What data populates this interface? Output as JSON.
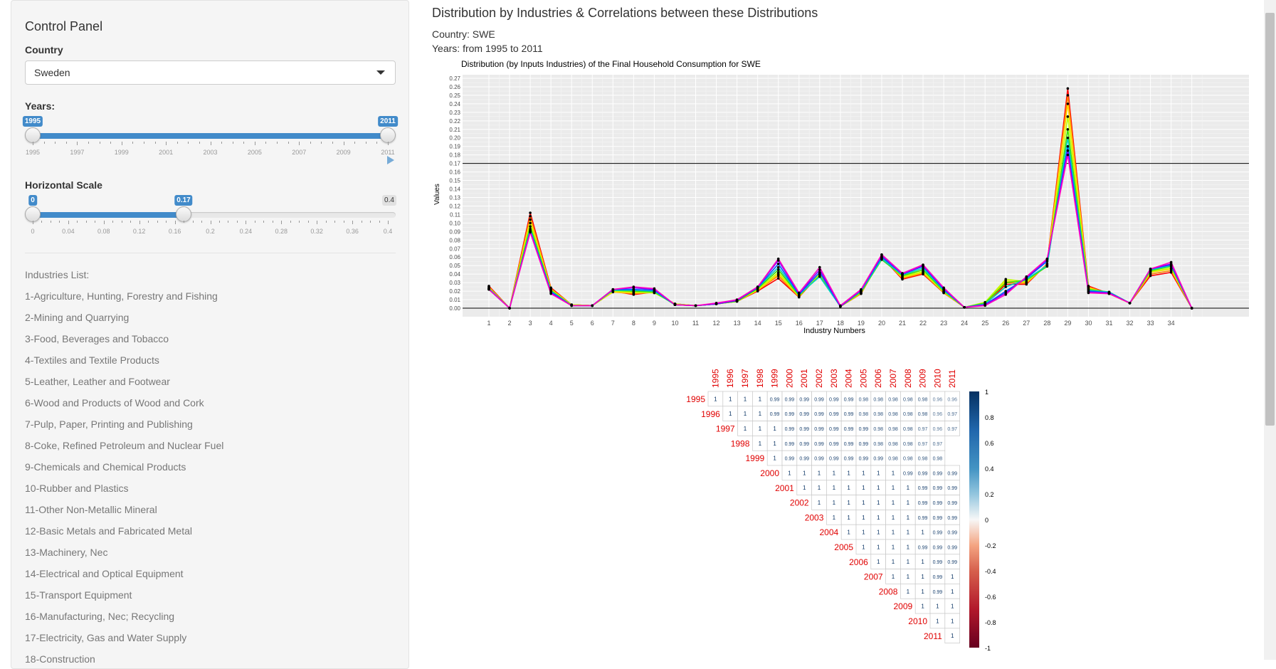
{
  "sidebar": {
    "title": "Control Panel",
    "country_label": "Country",
    "country_value": "Sweden",
    "years_label": "Years:",
    "years_from": "1995",
    "years_to": "2011",
    "years_ticks": [
      "1995",
      "1997",
      "1999",
      "2001",
      "2003",
      "2005",
      "2007",
      "2009",
      "2011"
    ],
    "hscale_label": "Horizontal Scale",
    "hscale_from": "0",
    "hscale_to": "0.17",
    "hscale_max": "0.4",
    "hscale_ticks": [
      "0",
      "0.04",
      "0.08",
      "0.12",
      "0.16",
      "0.2",
      "0.24",
      "0.28",
      "0.32",
      "0.36",
      "0.4"
    ],
    "industries_title": "Industries List:",
    "industries": [
      "1-Agriculture, Hunting, Forestry and Fishing",
      "2-Mining and Quarrying",
      "3-Food, Beverages and Tobacco",
      "4-Textiles and Textile Products",
      "5-Leather, Leather and Footwear",
      "6-Wood and Products of Wood and Cork",
      "7-Pulp, Paper, Printing and Publishing",
      "8-Coke, Refined Petroleum and Nuclear Fuel",
      "9-Chemicals and Chemical Products",
      "10-Rubber and Plastics",
      "11-Other Non-Metallic Mineral",
      "12-Basic Metals and Fabricated Metal",
      "13-Machinery, Nec",
      "14-Electrical and Optical Equipment",
      "15-Transport Equipment",
      "16-Manufacturing, Nec; Recycling",
      "17-Electricity, Gas and Water Supply",
      "18-Construction"
    ]
  },
  "main": {
    "title": "Distribution by Industries & Correlations between these Distributions",
    "country_line": "Country: SWE",
    "years_line": "Years: from 1995 to 2011"
  },
  "chart_data": [
    {
      "type": "line",
      "title": "Distribution (by Inputs Industries) of the Final Household Consumption for  SWE",
      "xlabel": "Industry Numbers",
      "ylabel": "Values",
      "ylim": [
        0,
        0.27
      ],
      "yticks": [
        "0.00",
        "0.01",
        "0.02",
        "0.03",
        "0.04",
        "0.05",
        "0.06",
        "0.07",
        "0.08",
        "0.09",
        "0.10",
        "0.11",
        "0.12",
        "0.13",
        "0.14",
        "0.15",
        "0.16",
        "0.17",
        "0.18",
        "0.19",
        "0.20",
        "0.21",
        "0.22",
        "0.23",
        "0.24",
        "0.25",
        "0.26",
        "0.27"
      ],
      "x": [
        1,
        2,
        3,
        4,
        5,
        6,
        7,
        8,
        9,
        10,
        11,
        12,
        13,
        14,
        15,
        16,
        17,
        18,
        19,
        20,
        21,
        22,
        23,
        24,
        25,
        26,
        27,
        28,
        29,
        30,
        31,
        32,
        33,
        34,
        35
      ],
      "xtick_labels": [
        "1",
        "2",
        "3",
        "4",
        "5",
        "6",
        "7",
        "8",
        "9",
        "10",
        "11",
        "12",
        "13",
        "14",
        "15",
        "16",
        "17",
        "18",
        "19",
        "20",
        "21",
        "22",
        "23",
        "24",
        "25",
        "26",
        "27",
        "28",
        "29",
        "30",
        "31",
        "32",
        "33",
        "34"
      ],
      "hlines": [
        0,
        0.17
      ],
      "grid": true,
      "series": [
        {
          "color": "#ff0000",
          "values": [
            0.026,
            0,
            0.112,
            0.024,
            0.004,
            0.003,
            0.02,
            0.016,
            0.019,
            0.005,
            0.003,
            0.005,
            0.008,
            0.02,
            0.035,
            0.013,
            0.04,
            0.002,
            0.017,
            0.06,
            0.034,
            0.04,
            0.018,
            0.001,
            0.004,
            0.028,
            0.028,
            0.052,
            0.258,
            0.026,
            0.017,
            0.006,
            0.038,
            0.042,
            0
          ]
        },
        {
          "color": "#ff8000",
          "values": [
            0.025,
            0,
            0.108,
            0.023,
            0.004,
            0.003,
            0.019,
            0.017,
            0.019,
            0.005,
            0.003,
            0.005,
            0.008,
            0.021,
            0.038,
            0.013,
            0.041,
            0.002,
            0.017,
            0.06,
            0.035,
            0.041,
            0.018,
            0.001,
            0.005,
            0.03,
            0.029,
            0.052,
            0.25,
            0.025,
            0.017,
            0.006,
            0.04,
            0.044,
            0
          ]
        },
        {
          "color": "#ffd700",
          "values": [
            0.024,
            0,
            0.104,
            0.022,
            0.004,
            0.003,
            0.019,
            0.018,
            0.018,
            0.005,
            0.003,
            0.005,
            0.008,
            0.021,
            0.04,
            0.014,
            0.041,
            0.002,
            0.018,
            0.059,
            0.036,
            0.042,
            0.019,
            0.001,
            0.006,
            0.032,
            0.03,
            0.051,
            0.24,
            0.024,
            0.017,
            0.006,
            0.042,
            0.046,
            0
          ]
        },
        {
          "color": "#c0ff00",
          "values": [
            0.023,
            0,
            0.1,
            0.021,
            0.004,
            0.003,
            0.02,
            0.019,
            0.018,
            0.005,
            0.003,
            0.005,
            0.008,
            0.022,
            0.042,
            0.014,
            0.04,
            0.002,
            0.018,
            0.058,
            0.037,
            0.043,
            0.019,
            0.001,
            0.007,
            0.034,
            0.031,
            0.05,
            0.225,
            0.023,
            0.018,
            0.006,
            0.043,
            0.047,
            0
          ]
        },
        {
          "color": "#40e000",
          "values": [
            0.023,
            0,
            0.096,
            0.021,
            0.003,
            0.003,
            0.021,
            0.02,
            0.019,
            0.004,
            0.003,
            0.005,
            0.008,
            0.023,
            0.045,
            0.015,
            0.038,
            0.002,
            0.019,
            0.057,
            0.038,
            0.045,
            0.02,
            0.001,
            0.006,
            0.03,
            0.033,
            0.049,
            0.21,
            0.022,
            0.019,
            0.006,
            0.044,
            0.049,
            0
          ]
        },
        {
          "color": "#00d0c0",
          "values": [
            0.023,
            0,
            0.093,
            0.02,
            0.003,
            0.003,
            0.021,
            0.021,
            0.02,
            0.004,
            0.003,
            0.005,
            0.009,
            0.024,
            0.048,
            0.016,
            0.037,
            0.002,
            0.02,
            0.058,
            0.039,
            0.047,
            0.021,
            0.001,
            0.005,
            0.025,
            0.034,
            0.05,
            0.2,
            0.021,
            0.019,
            0.006,
            0.045,
            0.05,
            0
          ]
        },
        {
          "color": "#0060ff",
          "values": [
            0.022,
            0,
            0.091,
            0.019,
            0.003,
            0.003,
            0.022,
            0.022,
            0.021,
            0.004,
            0.003,
            0.005,
            0.009,
            0.024,
            0.052,
            0.016,
            0.042,
            0.002,
            0.021,
            0.06,
            0.04,
            0.049,
            0.022,
            0.001,
            0.004,
            0.02,
            0.035,
            0.055,
            0.19,
            0.02,
            0.018,
            0.006,
            0.046,
            0.051,
            0
          ]
        },
        {
          "color": "#8000ff",
          "values": [
            0.022,
            0,
            0.09,
            0.018,
            0.003,
            0.003,
            0.022,
            0.024,
            0.022,
            0.004,
            0.003,
            0.005,
            0.009,
            0.025,
            0.056,
            0.017,
            0.045,
            0.002,
            0.021,
            0.062,
            0.04,
            0.05,
            0.023,
            0.001,
            0.004,
            0.018,
            0.036,
            0.057,
            0.185,
            0.019,
            0.018,
            0.006,
            0.046,
            0.052,
            0
          ]
        },
        {
          "color": "#ff00c0",
          "values": [
            0.022,
            0,
            0.089,
            0.017,
            0.003,
            0.003,
            0.022,
            0.025,
            0.023,
            0.004,
            0.003,
            0.006,
            0.01,
            0.025,
            0.058,
            0.018,
            0.048,
            0.003,
            0.022,
            0.063,
            0.041,
            0.051,
            0.024,
            0.001,
            0.003,
            0.016,
            0.037,
            0.058,
            0.18,
            0.018,
            0.017,
            0.006,
            0.046,
            0.054,
            0
          ]
        }
      ]
    },
    {
      "type": "heatmap",
      "labels": [
        "1995",
        "1996",
        "1997",
        "1998",
        "1999",
        "2000",
        "2001",
        "2002",
        "2003",
        "2004",
        "2005",
        "2006",
        "2007",
        "2008",
        "2009",
        "2010",
        "2011"
      ],
      "colorbar_ticks": [
        "1",
        "0.8",
        "0.6",
        "0.4",
        "0.2",
        "0",
        "-0.2",
        "-0.4",
        "-0.6",
        "-0.8",
        "-1"
      ],
      "matrix": [
        [
          "1",
          "1",
          "1",
          "1",
          "0.99",
          "0.99",
          "0.99",
          "0.99",
          "0.99",
          "0.99",
          "0.98",
          "0.98",
          "0.98",
          "0.98",
          "0.98",
          "0.96",
          "0.96"
        ],
        [
          "1",
          "1",
          "1",
          "0.99",
          "0.99",
          "0.99",
          "0.99",
          "0.99",
          "0.99",
          "0.98",
          "0.98",
          "0.98",
          "0.98",
          "0.98",
          "0.96",
          "0.97"
        ],
        [
          "1",
          "1",
          "1",
          "0.99",
          "0.99",
          "0.99",
          "0.99",
          "0.99",
          "0.99",
          "0.98",
          "0.98",
          "0.98",
          "0.97",
          "0.96",
          "0.97"
        ],
        [
          "1",
          "1",
          "0.99",
          "0.99",
          "0.99",
          "0.99",
          "0.99",
          "0.99",
          "0.98",
          "0.98",
          "0.98",
          "0.97",
          "0.97"
        ],
        [
          "1",
          "0.99",
          "0.99",
          "0.99",
          "0.99",
          "0.99",
          "0.99",
          "0.99",
          "0.98",
          "0.98",
          "0.98",
          "0.98"
        ],
        [
          "1",
          "1",
          "1",
          "1",
          "1",
          "1",
          "1",
          "1",
          "0.99",
          "0.99",
          "0.99",
          "0.99"
        ],
        [
          "1",
          "1",
          "1",
          "1",
          "1",
          "1",
          "1",
          "1",
          "0.99",
          "0.99",
          "0.99"
        ],
        [
          "1",
          "1",
          "1",
          "1",
          "1",
          "1",
          "1",
          "0.99",
          "0.99",
          "0.99"
        ],
        [
          "1",
          "1",
          "1",
          "1",
          "1",
          "1",
          "0.99",
          "0.99",
          "0.99"
        ],
        [
          "1",
          "1",
          "1",
          "1",
          "1",
          "1",
          "0.99",
          "0.99"
        ],
        [
          "1",
          "1",
          "1",
          "1",
          "0.99",
          "0.99",
          "0.99"
        ],
        [
          "1",
          "1",
          "1",
          "1",
          "0.99",
          "0.99"
        ],
        [
          "1",
          "1",
          "1",
          "0.99",
          "1"
        ],
        [
          "1",
          "1",
          "0.99",
          "1"
        ],
        [
          "1",
          "1",
          "1"
        ],
        [
          "1",
          "1"
        ],
        [
          "1"
        ]
      ]
    }
  ]
}
